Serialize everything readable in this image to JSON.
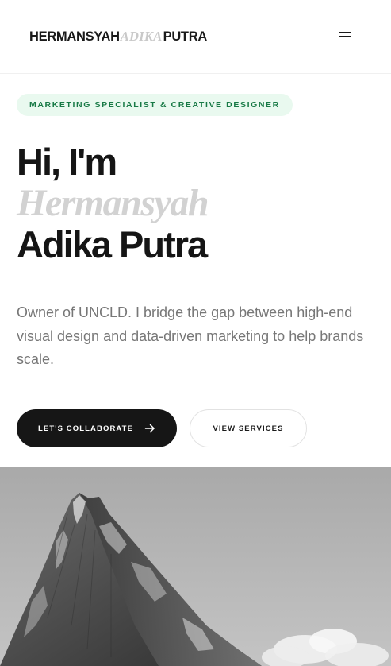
{
  "header": {
    "logo_first": "HERMANSYAH",
    "logo_accent": "ADIKA",
    "logo_last": "PUTRA",
    "menu_icon": "hamburger-menu-icon"
  },
  "hero": {
    "badge": "MARKETING SPECIALIST & CREATIVE DESIGNER",
    "title_line1": "Hi, I'm",
    "title_line2": "Hermansyah",
    "title_line3": "Adika Putra",
    "description": "Owner of UNCLD. I bridge the gap between high-end visual design and data-driven marketing to help brands scale.",
    "primary_button": "LET'S COLLABORATE",
    "primary_button_icon": "arrow-right-icon",
    "secondary_button": "VIEW SERVICES"
  },
  "colors": {
    "badge_bg": "#e9f9ef",
    "badge_text": "#187a46",
    "primary_button_bg": "#161616",
    "accent_gray": "#d2d2d2"
  }
}
